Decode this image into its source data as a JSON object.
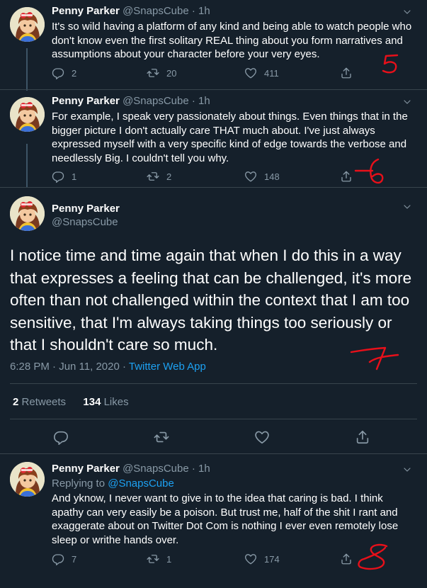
{
  "author": {
    "name": "Penny Parker",
    "handle": "@SnapsCube"
  },
  "tweets": [
    {
      "time": "1h",
      "text": "It's so wild having a platform of any kind and being able to watch people who don't know even the first solitary REAL thing about you form narratives and assumptions about your character before your very eyes.",
      "replies": "2",
      "retweets": "20",
      "likes": "411"
    },
    {
      "time": "1h",
      "text": "For example, I speak very passionately about things. Even things that in the bigger picture I don't actually care THAT much about. I've just always expressed myself with a very specific kind of edge towards the verbose and needlessly Big. I couldn't tell you why.",
      "replies": "1",
      "retweets": "2",
      "likes": "148"
    }
  ],
  "focused": {
    "text": "I notice time and time again that when I do this in a way that expresses a feeling that can be challenged, it's more often than not challenged within the context that I am too sensitive, that I'm always taking things too seriously or that I shouldn't care so much.",
    "timestamp": "6:28 PM · Jun 11, 2020 · ",
    "source": "Twitter Web App",
    "retweet_count": "2",
    "retweet_label": "Retweets",
    "like_count": "134",
    "like_label": "Likes"
  },
  "reply": {
    "time": "1h",
    "replying_to_label": "Replying to ",
    "replying_to": "@SnapsCube",
    "text": "And yknow, I never want to give in to the idea that caring is bad. I think apathy can very easily be a poison. But trust me, half of the shit I rant and exaggerate about on Twitter Dot Com is nothing I ever even remotely lose sleep or writhe hands over.",
    "replies": "7",
    "retweets": "1",
    "likes": "174"
  },
  "separator": " · ",
  "annotation_color": "#e8101a",
  "icons": [
    "reply-icon",
    "retweet-icon",
    "like-icon",
    "share-icon",
    "chevron-down-icon"
  ]
}
